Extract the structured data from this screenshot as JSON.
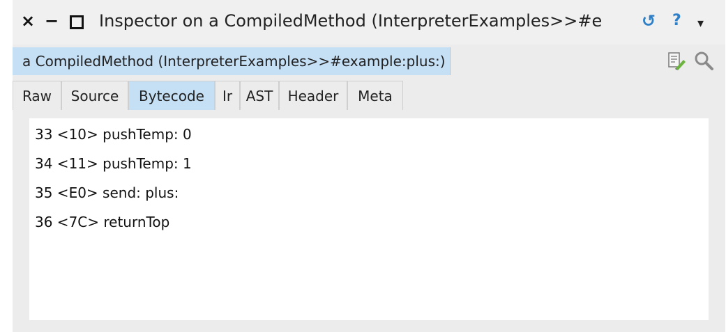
{
  "window": {
    "title": "Inspector on a CompiledMethod (InterpreterExamples>>#e",
    "close_glyph": "×",
    "minimize_glyph": "−"
  },
  "toolbar": {
    "help_glyph": "?",
    "menu_glyph": "▾",
    "refresh_glyph": "↺",
    "icons": [
      "refresh-icon",
      "help-icon",
      "menu-icon",
      "browse-icon",
      "search-icon"
    ]
  },
  "object_tab": {
    "label": "a CompiledMethod (InterpreterExamples>>#example:plus:)"
  },
  "tabs": [
    {
      "label": "Raw"
    },
    {
      "label": "Source"
    },
    {
      "label": "Bytecode"
    },
    {
      "label": "Ir"
    },
    {
      "label": "AST"
    },
    {
      "label": "Header"
    },
    {
      "label": "Meta"
    }
  ],
  "active_tab": "Bytecode",
  "bytecode": [
    "33 <10> pushTemp: 0",
    "34 <11> pushTemp: 1",
    "35 <E0> send: plus:",
    "36 <7C> returnTop"
  ],
  "colors": {
    "active_tab": "#c5dff5",
    "accent_icon": "#2f7fc8"
  }
}
